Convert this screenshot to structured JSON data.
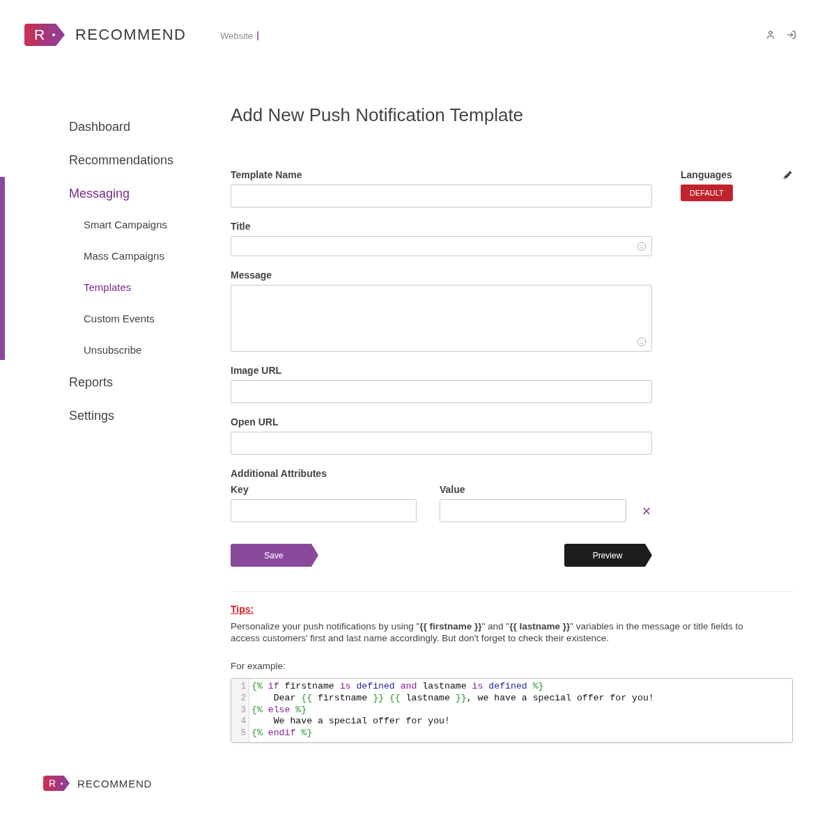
{
  "header": {
    "logo": {
      "mark": "R",
      "name": "RECOMMEND"
    },
    "site_selector": {
      "label": "Website"
    }
  },
  "sidebar": {
    "items": [
      {
        "label": "Dashboard",
        "selected": false
      },
      {
        "label": "Recommendations",
        "selected": false
      },
      {
        "label": "Messaging",
        "selected": true,
        "children": [
          {
            "label": "Smart Campaigns",
            "selected": false
          },
          {
            "label": "Mass Campaigns",
            "selected": false
          },
          {
            "label": "Templates",
            "selected": true
          },
          {
            "label": "Custom Events",
            "selected": false
          },
          {
            "label": "Unsubscribe",
            "selected": false
          }
        ]
      },
      {
        "label": "Reports",
        "selected": false
      },
      {
        "label": "Settings",
        "selected": false
      }
    ]
  },
  "page": {
    "title": "Add New Push Notification Template"
  },
  "form": {
    "fields": [
      {
        "label": "Template Name",
        "kind": "input"
      },
      {
        "label": "Title",
        "kind": "emoji-input"
      },
      {
        "label": "Message",
        "kind": "emoji-textarea"
      },
      {
        "label": "Image URL",
        "kind": "input"
      },
      {
        "label": "Open URL",
        "kind": "input"
      }
    ],
    "additional_attributes": {
      "label": "Additional Attributes",
      "key_label": "Key",
      "value_label": "Value"
    },
    "buttons": [
      {
        "label": "Save",
        "kind": "primary"
      },
      {
        "label": "Preview",
        "kind": "dark"
      }
    ]
  },
  "languages": {
    "label": "Languages",
    "badges": [
      "DEFAULT"
    ]
  },
  "tips": {
    "heading": "Tips:",
    "text": "Personalize your push notifications by using \"**{{ firstname }}**\" and \"**{{ lastname }}**\" variables in the message or title fields to access customers' first and last name accordingly. But don't forget to check their existence.",
    "example_label": "For example:",
    "code_lines": [
      {
        "number": "1",
        "tokens": [
          {
            "kind": "tag",
            "text": "{% "
          },
          {
            "kind": "keyword",
            "text": "if"
          },
          {
            "kind": "plain",
            "text": " firstname "
          },
          {
            "kind": "keyword",
            "text": "is "
          },
          {
            "kind": "test",
            "text": "defined "
          },
          {
            "kind": "keyword",
            "text": "and"
          },
          {
            "kind": "plain",
            "text": " lastname "
          },
          {
            "kind": "keyword",
            "text": "is "
          },
          {
            "kind": "test",
            "text": "defined "
          },
          {
            "kind": "tag",
            "text": "%}"
          }
        ]
      },
      {
        "number": "2",
        "tokens": [
          {
            "kind": "plain",
            "text": "    Dear "
          },
          {
            "kind": "tag",
            "text": "{{"
          },
          {
            "kind": "plain",
            "text": " firstname "
          },
          {
            "kind": "tag",
            "text": "}} {{"
          },
          {
            "kind": "plain",
            "text": " lastname "
          },
          {
            "kind": "tag",
            "text": "}}"
          },
          {
            "kind": "plain",
            "text": ", we have a special offer for you!"
          }
        ]
      },
      {
        "number": "3",
        "tokens": [
          {
            "kind": "tag",
            "text": "{% "
          },
          {
            "kind": "keyword",
            "text": "else "
          },
          {
            "kind": "tag",
            "text": "%}"
          }
        ]
      },
      {
        "number": "4",
        "tokens": [
          {
            "kind": "plain",
            "text": "    We have a special offer for you!"
          }
        ]
      },
      {
        "number": "5",
        "tokens": [
          {
            "kind": "tag",
            "text": "{% "
          },
          {
            "kind": "keyword",
            "text": "endif "
          },
          {
            "kind": "tag",
            "text": "%}"
          }
        ]
      }
    ]
  },
  "footer": {
    "logo": {
      "mark": "R",
      "name": "RECOMMEND"
    }
  }
}
